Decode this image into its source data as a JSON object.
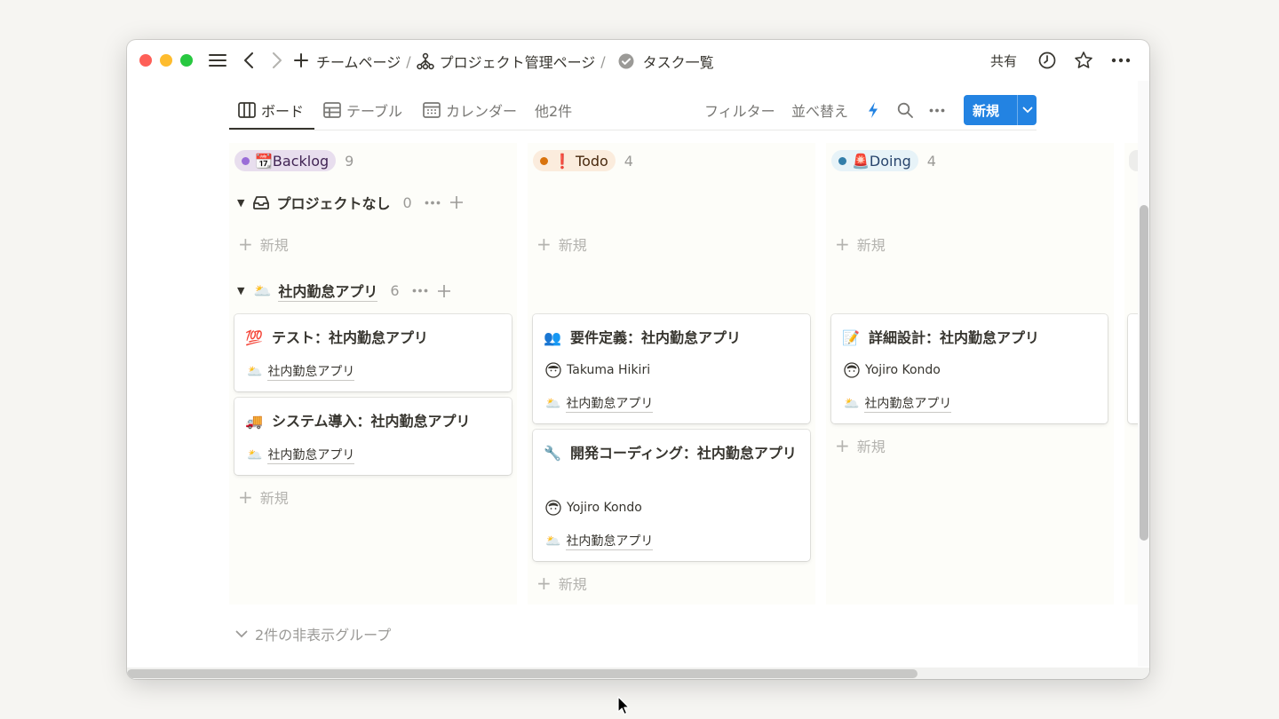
{
  "breadcrumb": {
    "items": [
      "チームページ",
      "プロジェクト管理ページ",
      "タスク一覧"
    ],
    "separator": "/"
  },
  "topbar": {
    "share_label": "共有"
  },
  "views": {
    "tabs": [
      "ボード",
      "テーブル",
      "カレンダー"
    ],
    "more_label": "他2件",
    "filter_label": "フィルター",
    "sort_label": "並べ替え",
    "new_label": "新規"
  },
  "columns": [
    {
      "label": "📆Backlog",
      "count": "9",
      "dot": "#9a6dd7",
      "bg": "#e8deee",
      "text": "#412454"
    },
    {
      "label": "❗ Todo",
      "count": "4",
      "dot": "#d9730d",
      "bg": "#fbecdd",
      "text": "#49290e"
    },
    {
      "label": "🚨Doing",
      "count": "4",
      "dot": "#337ea9",
      "bg": "#e7f3f8",
      "text": "#28456c"
    }
  ],
  "groups": [
    {
      "label": "プロジェクトなし",
      "icon": "inbox-icon",
      "count": "0"
    },
    {
      "label": "社内勤怠アプリ",
      "icon": "cloud-sun-emoji",
      "count": "6"
    }
  ],
  "add_label": "新規",
  "cards": [
    {
      "emoji": "💯",
      "title": "テスト：社内勤怠アプリ",
      "relation": "社内勤怠アプリ",
      "relation_emoji": "🌥️"
    },
    {
      "emoji": "🚚",
      "title": "システム導入：社内勤怠アプリ",
      "relation": "社内勤怠アプリ",
      "relation_emoji": "🌥️"
    },
    {
      "emoji": "👥",
      "title": "要件定義：社内勤怠アプリ",
      "assignee": "Takuma Hikiri",
      "relation": "社内勤怠アプリ",
      "relation_emoji": "🌥️"
    },
    {
      "emoji": "🔧",
      "title": "開発コーディング：社内勤怠アプリ",
      "assignee": "Yojiro Kondo",
      "relation": "社内勤怠アプリ",
      "relation_emoji": "🌥️"
    },
    {
      "emoji": "📝",
      "title": "詳細設計：社内勤怠アプリ",
      "assignee": "Yojiro Kondo",
      "relation": "社内勤怠アプリ",
      "relation_emoji": "🌥️"
    }
  ],
  "hidden_groups_label": "2件の非表示グループ"
}
